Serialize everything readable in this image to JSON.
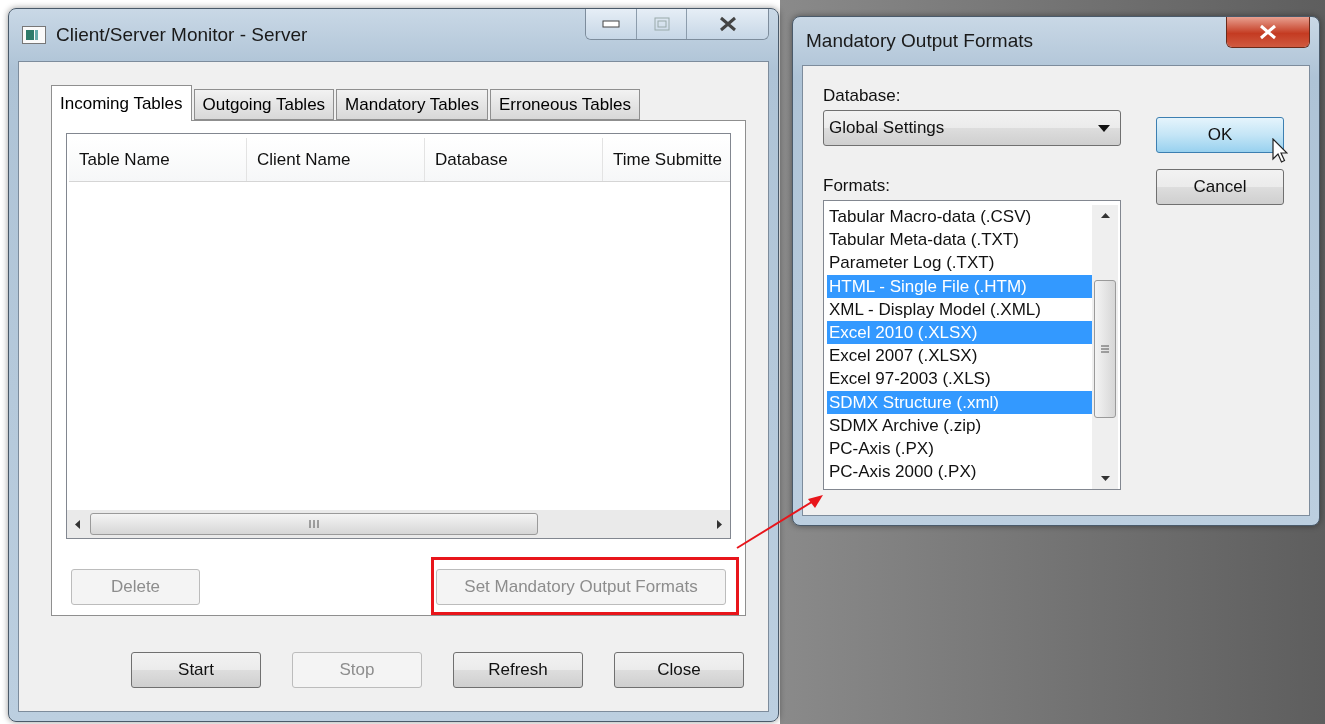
{
  "main_window": {
    "title": "Client/Server Monitor - Server",
    "tabs": [
      {
        "label": "Incoming Tables",
        "selected": true
      },
      {
        "label": "Outgoing Tables",
        "selected": false
      },
      {
        "label": "Mandatory Tables",
        "selected": false
      },
      {
        "label": "Erroneous Tables",
        "selected": false
      }
    ],
    "table": {
      "columns": [
        "Table Name",
        "Client Name",
        "Database",
        "Time Submitte"
      ]
    },
    "panel_buttons": [
      {
        "label": "Delete",
        "disabled": true,
        "highlighted": false
      },
      {
        "label": "Set Mandatory Output Formats",
        "disabled": true,
        "highlighted": true
      }
    ],
    "buttons": [
      {
        "label": "Start",
        "disabled": false
      },
      {
        "label": "Stop",
        "disabled": true
      },
      {
        "label": "Refresh",
        "disabled": false
      },
      {
        "label": "Close",
        "disabled": false
      }
    ]
  },
  "dialog": {
    "title": "Mandatory Output Formats",
    "database_label": "Database:",
    "database_value": "Global Settings",
    "formats_label": "Formats:",
    "formats": [
      {
        "label": "Tabular Macro-data (.CSV)",
        "selected": false
      },
      {
        "label": "Tabular Meta-data (.TXT)",
        "selected": false
      },
      {
        "label": "Parameter Log (.TXT)",
        "selected": false
      },
      {
        "label": "HTML - Single File (.HTM)",
        "selected": true
      },
      {
        "label": "XML - Display Model (.XML)",
        "selected": false
      },
      {
        "label": "Excel 2010 (.XLSX)",
        "selected": true
      },
      {
        "label": "Excel 2007 (.XLSX)",
        "selected": false
      },
      {
        "label": "Excel 97-2003 (.XLS)",
        "selected": false
      },
      {
        "label": "SDMX Structure (.xml)",
        "selected": true
      },
      {
        "label": "SDMX Archive (.zip)",
        "selected": false
      },
      {
        "label": "PC-Axis (.PX)",
        "selected": false
      },
      {
        "label": "PC-Axis 2000 (.PX)",
        "selected": false
      }
    ],
    "buttons": [
      {
        "label": "OK",
        "default": true
      },
      {
        "label": "Cancel",
        "default": false
      }
    ]
  }
}
